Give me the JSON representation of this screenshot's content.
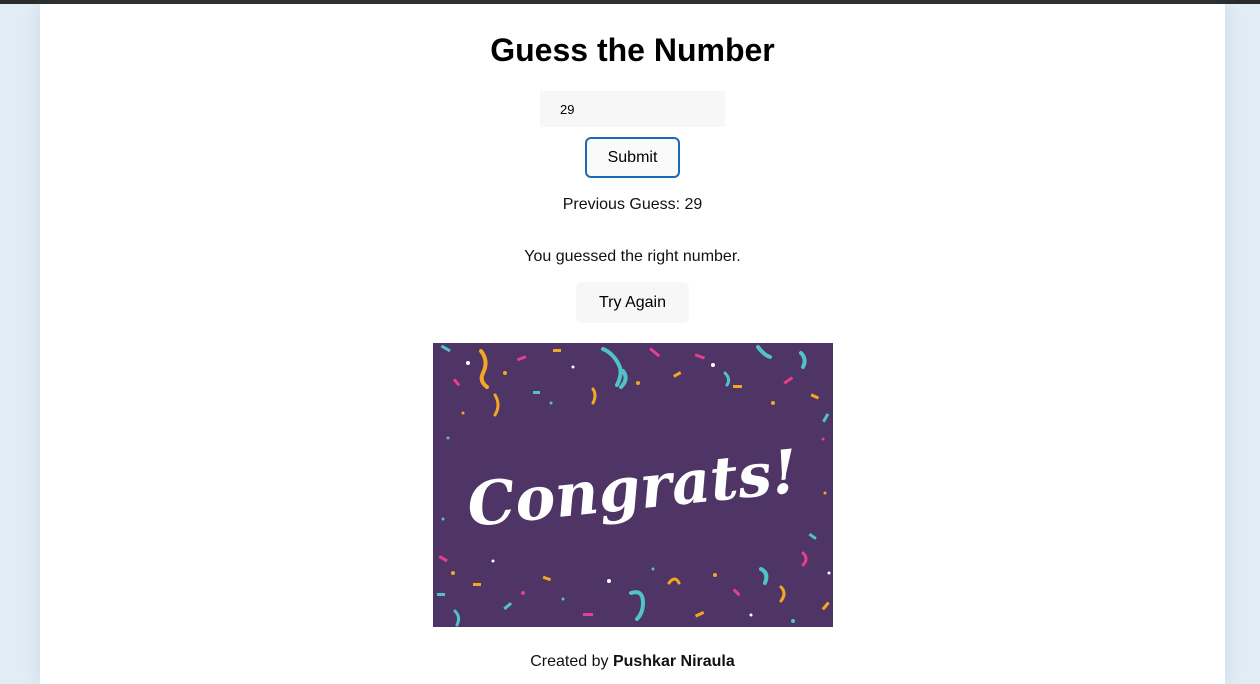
{
  "page": {
    "title": "Guess the Number"
  },
  "guess_form": {
    "input_value": "29",
    "submit_label": "Submit"
  },
  "status": {
    "previous_guess_label": "Previous Guess: 29",
    "result_message": "You guessed the right number.",
    "try_again_label": "Try Again"
  },
  "image": {
    "text": "Congrats!",
    "background_color": "#4e3565",
    "confetti_colors": [
      "#f5a623",
      "#4fc3c7",
      "#e83e8c",
      "#ffffff"
    ]
  },
  "footer": {
    "prefix": "Created by",
    "author": "Pushkar Niraula"
  }
}
